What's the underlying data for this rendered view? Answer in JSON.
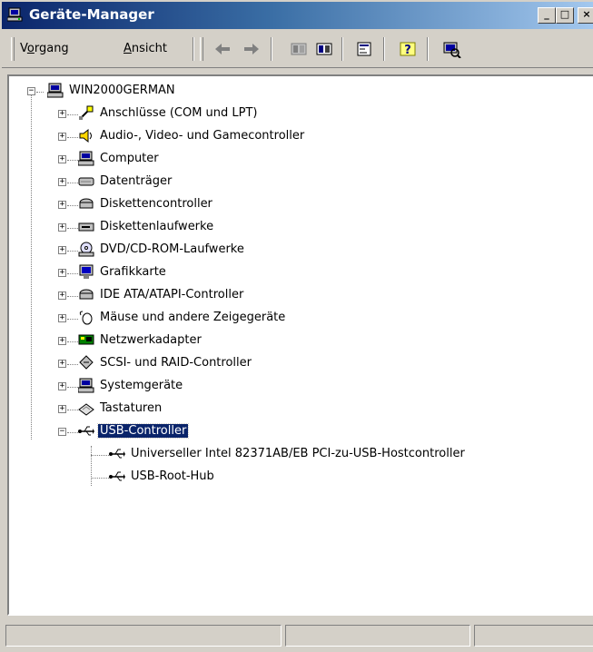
{
  "window": {
    "title": "Geräte-Manager",
    "controls": {
      "minimize": "_",
      "maximize": "□",
      "close": "×"
    }
  },
  "toolbar": {
    "menus": [
      {
        "label_pre": "V",
        "label_u": "o",
        "label_post": "rgang"
      },
      {
        "label_pre": "",
        "label_u": "A",
        "label_post": "nsicht"
      }
    ],
    "icons": [
      "back-arrow-icon",
      "forward-arrow-icon",
      "computer-list-icon",
      "view-toggle-icon",
      "properties-icon",
      "help-icon",
      "scan-hardware-icon"
    ]
  },
  "tree": {
    "root": "WIN2000GERMAN",
    "categories": [
      {
        "label": "Anschlüsse (COM und LPT)",
        "icon": "port-icon"
      },
      {
        "label": "Audio-, Video- und Gamecontroller",
        "icon": "speaker-icon"
      },
      {
        "label": "Computer",
        "icon": "computer-icon"
      },
      {
        "label": "Datenträger",
        "icon": "disk-drive-icon"
      },
      {
        "label": "Diskettencontroller",
        "icon": "floppy-controller-icon"
      },
      {
        "label": "Diskettenlaufwerke",
        "icon": "floppy-drive-icon"
      },
      {
        "label": "DVD/CD-ROM-Laufwerke",
        "icon": "cdrom-icon"
      },
      {
        "label": "Grafikkarte",
        "icon": "display-adapter-icon"
      },
      {
        "label": "IDE ATA/ATAPI-Controller",
        "icon": "ide-controller-icon"
      },
      {
        "label": "Mäuse und andere Zeigegeräte",
        "icon": "mouse-icon"
      },
      {
        "label": "Netzwerkadapter",
        "icon": "network-adapter-icon"
      },
      {
        "label": "SCSI- und RAID-Controller",
        "icon": "scsi-icon"
      },
      {
        "label": "Systemgeräte",
        "icon": "system-device-icon"
      },
      {
        "label": "Tastaturen",
        "icon": "keyboard-icon"
      },
      {
        "label": "USB-Controller",
        "icon": "usb-icon"
      }
    ],
    "usb_children": [
      "Universeller Intel 82371AB/EB PCI-zu-USB-Hostcontroller",
      "USB-Root-Hub"
    ],
    "selected": "USB-Controller"
  },
  "colors": {
    "selection": "#0a246a",
    "title_start": "#0a246a",
    "title_end": "#a6caf0",
    "face": "#d4d0c8"
  }
}
